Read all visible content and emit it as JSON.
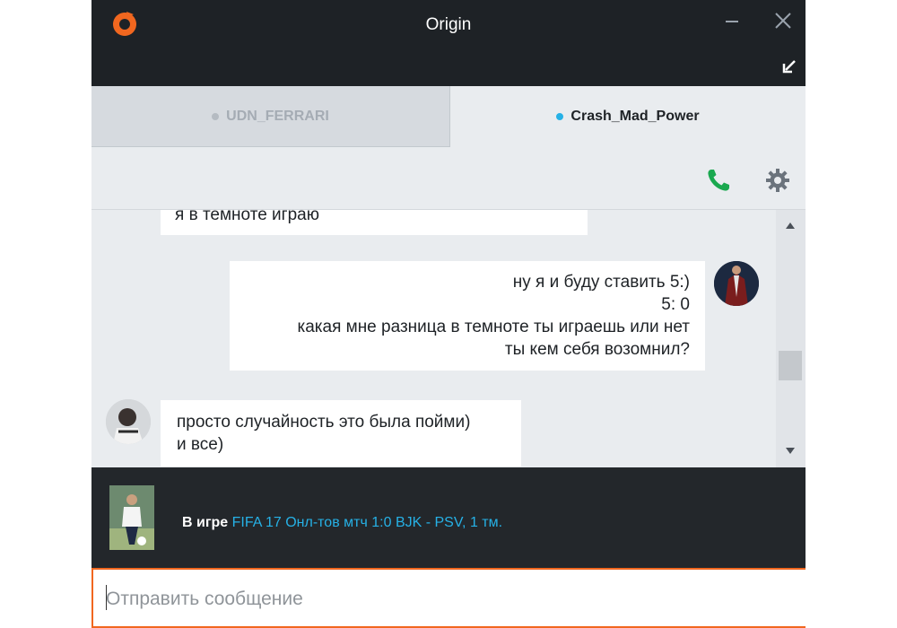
{
  "window": {
    "title": "Origin",
    "icons": {
      "logo": "origin-logo-icon",
      "minimize": "minimize-icon",
      "close": "close-icon",
      "popin": "popin-arrow-icon"
    }
  },
  "tabs": [
    {
      "label": "UDN_FERRARI",
      "active": false,
      "status_color": "#b5bbc2"
    },
    {
      "label": "Crash_Mad_Power",
      "active": true,
      "status_color": "#26b1e6"
    }
  ],
  "toolbar": {
    "icons": [
      "phone-icon",
      "gear-icon"
    ],
    "phone_color": "#1aa84f"
  },
  "messages": [
    {
      "sender": "friend",
      "lines": [
        "я в темноте играю"
      ]
    },
    {
      "sender": "me",
      "lines": [
        "ну я и буду ставить 5:)",
        "5: 0",
        "какая мне разница в темноте ты играешь или нет",
        "ты кем себя возомнил?"
      ]
    },
    {
      "sender": "friend",
      "lines": [
        "просто случайность это была пойми)",
        "и все)"
      ]
    }
  ],
  "scrollbar": {
    "position": 0.62
  },
  "status": {
    "label": "В игре",
    "game": "FIFA 17 Онл-тов мтч 1:0 BJK - PSV, 1 тм."
  },
  "input": {
    "placeholder": "Отправить сообщение",
    "value": ""
  },
  "colors": {
    "accent": "#f1671f",
    "link": "#26b1e6",
    "titlebar": "#1e2226",
    "status_bar": "#23272b"
  }
}
